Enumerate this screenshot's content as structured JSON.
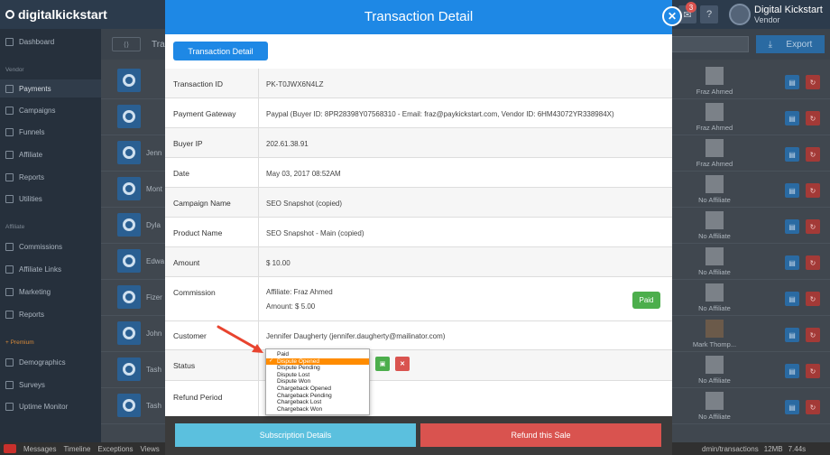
{
  "app": {
    "logo": "digitalkickstart",
    "brand_title": "Digital Kickstart",
    "brand_sub": "Vendor",
    "notif_count": "3",
    "help": "?"
  },
  "sidebar": {
    "dashboard": "Dashboard",
    "vendor_head": "Vendor",
    "vendor_items": [
      "Payments",
      "Campaigns",
      "Funnels",
      "Affiliate",
      "Reports",
      "Utilities"
    ],
    "affiliate_head": "Affiliate",
    "affiliate_items": [
      "Commissions",
      "Affiliate Links",
      "Marketing",
      "Reports"
    ],
    "premium_head": "+ Premium",
    "premium_items": [
      "Demographics",
      "Surveys",
      "Uptime Monitor"
    ]
  },
  "content": {
    "tab": "Tra",
    "export_label": "Export",
    "rows": [
      {
        "name": "",
        "affiliate": "Fraz Ahmed"
      },
      {
        "name": "",
        "affiliate": "Fraz Ahmed"
      },
      {
        "name": "Jenn",
        "affiliate": "Fraz Ahmed"
      },
      {
        "name": "Mont",
        "affiliate": "No Affiliate"
      },
      {
        "name": "Dyla",
        "affiliate": "No Affiliate"
      },
      {
        "name": "Edwa",
        "affiliate": "No Affiliate"
      },
      {
        "name": "Fizer",
        "affiliate": "No Affiliate"
      },
      {
        "name": "John",
        "affiliate": "Mark Thomp..."
      },
      {
        "name": "Tash",
        "affiliate": "No Affiliate"
      },
      {
        "name": "Tash",
        "affiliate": "No Affiliate"
      }
    ]
  },
  "modal": {
    "title": "Transaction Detail",
    "tab_button": "Transaction Detail",
    "fields": [
      {
        "label": "Transaction ID",
        "value": "PK-T0JWX6N4LZ"
      },
      {
        "label": "Payment Gateway",
        "value": "Paypal (Buyer ID: 8PR28398Y07568310 - Email: fraz@paykickstart.com, Vendor ID: 6HM43072YR338984X)"
      },
      {
        "label": "Buyer IP",
        "value": "202.61.38.91"
      },
      {
        "label": "Date",
        "value": "May 03, 2017 08:52AM"
      },
      {
        "label": "Campaign Name",
        "value": "SEO Snapshot (copied)"
      },
      {
        "label": "Product Name",
        "value": "SEO Snapshot - Main (copied)"
      },
      {
        "label": "Amount",
        "value": "$ 10.00"
      }
    ],
    "commission": {
      "label": "Commission",
      "affiliate": "Affiliate: Fraz Ahmed",
      "amount": "Amount: $ 5.00",
      "status": "Paid"
    },
    "customer": {
      "label": "Customer",
      "value": "Jennifer Daugherty (jennifer.daugherty@mailinator.com)"
    },
    "status": {
      "label": "Status",
      "options": [
        "Paid",
        "Dispute Opened",
        "Dispute Pending",
        "Dispute Lost",
        "Dispute Won",
        "Chargeback Opened",
        "Chargeback Pending",
        "Chargeback Lost",
        "Chargeback Won"
      ],
      "selected": "Dispute Opened"
    },
    "refund_period": {
      "label": "Refund Period"
    },
    "footer": {
      "subscription": "Subscription Details",
      "refund": "Refund this Sale"
    }
  },
  "debugbar": {
    "items": [
      "Messages",
      "Timeline",
      "Exceptions",
      "Views"
    ],
    "route": "dmin/transactions",
    "memory": "12MB",
    "time": "7.44s"
  },
  "colors": {
    "primary": "#1e88e5",
    "success": "#4cae4c",
    "danger": "#d9534f",
    "info": "#5bc0de",
    "highlight": "#ff8c00",
    "arrow": "#e8442f"
  }
}
